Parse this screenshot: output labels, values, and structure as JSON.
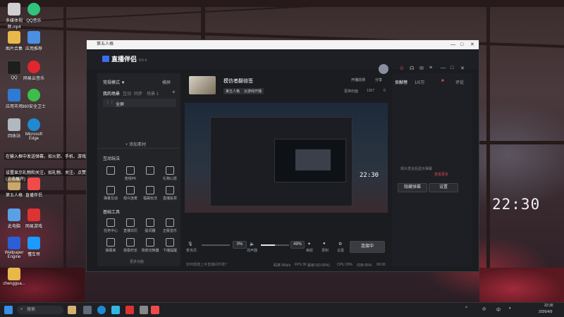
{
  "desktop": {
    "icons": [
      {
        "label": "多媒体视频.mp4",
        "color": "#d0d0d0"
      },
      {
        "label": "QQ音乐",
        "color": "#31c27c"
      },
      {
        "label": "图片合集",
        "color": "#e8b84a"
      },
      {
        "label": "应用推荐",
        "color": "#4a90e2"
      },
      {
        "label": "QQ",
        "color": "#1e90ff"
      },
      {
        "label": "网易云音乐",
        "color": "#e0262f"
      },
      {
        "label": "应用市场",
        "color": "#2e7bd6"
      },
      {
        "label": "360安全卫士",
        "color": "#3bbf4a"
      },
      {
        "label": "回收站",
        "color": "#b0b8c0"
      },
      {
        "label": "Microsoft Edge",
        "color": "#1f8ad2"
      },
      {
        "label": "Wallpaper Engine",
        "color": "#2a5fd6"
      },
      {
        "label": "懂车帝",
        "color": "#1b9bff"
      },
      {
        "label": "此电脑",
        "color": "#5aa0e6"
      },
      {
        "label": "网易游戏",
        "color": "#d33"
      },
      {
        "label": "第五人格",
        "color": "#c9a66b"
      },
      {
        "label": "直播伴侣",
        "color": "#f04a4a"
      },
      {
        "label": "chenggua...",
        "color": "#e8b84a"
      }
    ],
    "clock": "22:30"
  },
  "window": {
    "title": "第五人格",
    "app_name": "直播伴侣",
    "version": "8.5.4",
    "left": {
      "mode_label": "常规模式 ▼",
      "hot_label": "横屏",
      "tabs": [
        "我的场景",
        "互动",
        "同步",
        "场景 1"
      ],
      "scene_item": "全屏",
      "add_source": "+ 添加素材",
      "interact_title": "互动玩法",
      "interact_items": [
        "",
        "连线PK",
        "",
        "礼物心愿"
      ],
      "interact_items2": [
        "弹幕互动",
        "观众连麦",
        "福袋玩法",
        "直播投票"
      ],
      "tools_title": "基础工具",
      "tools": [
        "任务中心",
        "直播日历",
        "提词器",
        "正版音乐"
      ],
      "tools2": [
        "弹幕库",
        "观看时长",
        "场景切换器",
        "下播提醒"
      ],
      "more": "更多功能"
    },
    "center": {
      "stream_title": "模仿者翻倍签",
      "tags": [
        "第五人格",
        "云游戏开播"
      ],
      "cover_label": "更换封面",
      "top_actions": [
        "开播前测",
        "分享"
      ],
      "views_label": "1307",
      "likes_label": "0",
      "preview_clock": "22:30",
      "mic_label": "麦克风",
      "mic_value": "0%",
      "speaker_label": "扬声器",
      "speaker_value": "49%",
      "tools": [
        "美颜",
        "录制",
        "设置"
      ],
      "start_button": "连接中",
      "tip": "如何搭建上手直播间环境?",
      "status_items": [
        "码率 0Kb/s",
        "FPS 30",
        "丢帧 0(0.00%)",
        "CPU 29%",
        "内存 65%",
        "00:00"
      ]
    },
    "right": {
      "tabs": [
        "贡献榜",
        "1/0万",
        "评论"
      ],
      "empty_text": "观众发言后显示弹幕",
      "empty_link": "查看更多",
      "buttons": [
        "隐藏弹幕",
        "设置"
      ]
    }
  },
  "overlay": {
    "line1": "在输入框中发送弹幕，如火箭、手机、游戏、粉丝牌升级等",
    "line2": "设置显示礼物和关注，如礼物、关注、点赞、贵宾开通/续费、贴粉",
    "line3": "(点击展开)"
  },
  "taskbar": {
    "search_placeholder": "搜索",
    "tray_lang": "中",
    "time": "22:30",
    "date": "2026/4/9"
  }
}
